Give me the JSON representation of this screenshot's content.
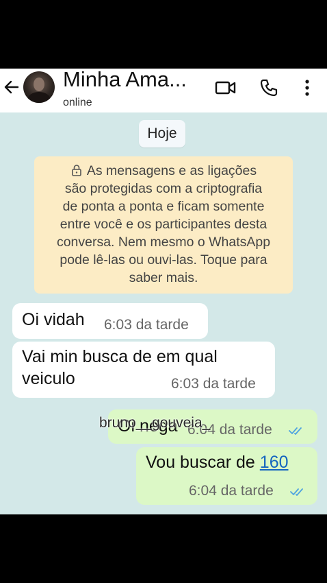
{
  "header": {
    "back_icon": "arrow-left-icon",
    "contact_name": "Minha Ama...",
    "status": "online",
    "video_icon": "video-camera-icon",
    "call_icon": "phone-icon",
    "menu_icon": "more-vertical-icon"
  },
  "date_chip": "Hoje",
  "notice": {
    "lines": [
      "As mensagens e as ligações",
      "são protegidas com a criptografia",
      "de ponta a ponta e ficam somente",
      "entre você e os participantes desta",
      "conversa. Nem mesmo o WhatsApp",
      "pode lê-las ou ouvi-las. Toque para",
      "saber mais."
    ],
    "icon": "lock-icon"
  },
  "messages": [
    {
      "direction": "incoming",
      "lines": [
        "Oi vidah"
      ],
      "time": "6:03 da tarde"
    },
    {
      "direction": "incoming",
      "lines": [
        "Vai min busca de em qual",
        "veiculo"
      ],
      "time": "6:03 da tarde"
    },
    {
      "direction": "outgoing",
      "lines": [
        "Oi nega"
      ],
      "time": "6:04 da tarde",
      "read": true
    },
    {
      "direction": "outgoing",
      "text_prefix": "Vou buscar de ",
      "link_text": "160",
      "time": "6:04 da tarde",
      "read": true
    }
  ],
  "watermark": "bruno__gouveia_",
  "colors": {
    "chat_background": "#d3e8e8",
    "incoming_bubble": "#ffffff",
    "outgoing_bubble": "#dcf8c6",
    "notice_background": "#fcecc5",
    "read_ticks": "#4fa3e0",
    "link": "#1565c0"
  }
}
